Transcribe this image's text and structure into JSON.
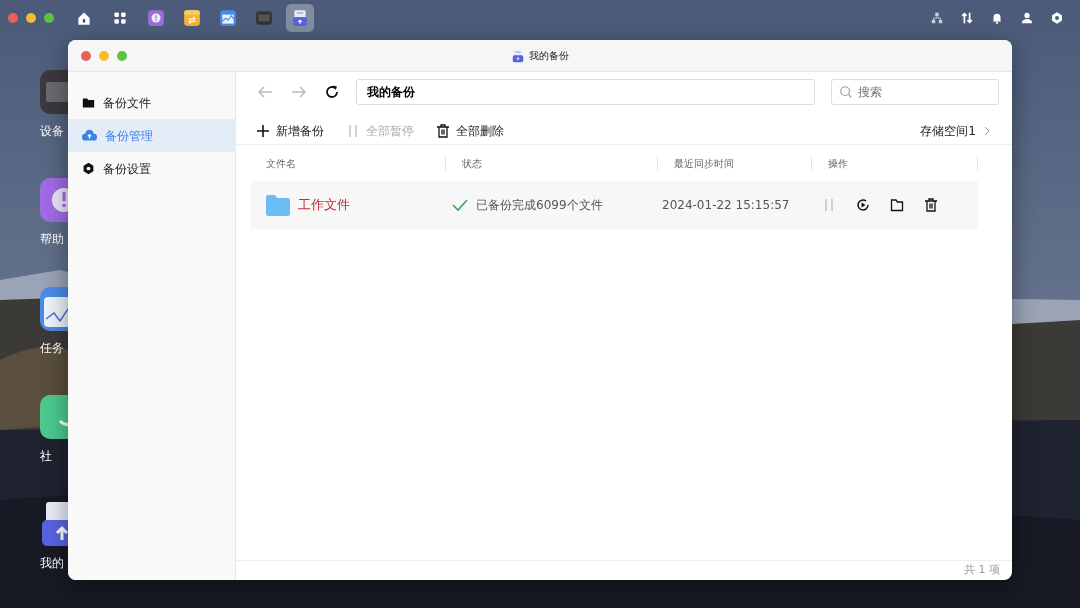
{
  "menu_bar": {
    "apps": [
      {
        "kind": "home",
        "selected": false
      },
      {
        "kind": "grid",
        "selected": false
      },
      {
        "kind": "help",
        "selected": false
      },
      {
        "kind": "sync",
        "selected": false
      },
      {
        "kind": "monitor",
        "selected": false
      },
      {
        "kind": "device",
        "selected": false
      },
      {
        "kind": "backup",
        "selected": true
      }
    ],
    "tray": [
      {
        "kind": "network"
      },
      {
        "kind": "transfer"
      },
      {
        "kind": "bell"
      },
      {
        "kind": "user"
      },
      {
        "kind": "settings"
      }
    ]
  },
  "desktop_icons": [
    {
      "label": "设备",
      "kind": "device"
    },
    {
      "label": "帮助",
      "kind": "help"
    },
    {
      "label": "任务",
      "kind": "monitor"
    },
    {
      "label": "社",
      "kind": "community"
    },
    {
      "label": "我的",
      "kind": "backup"
    }
  ],
  "window": {
    "title": "我的备份",
    "sidebar": [
      {
        "label": "备份文件",
        "kind": "folder",
        "selected": false
      },
      {
        "label": "备份管理",
        "kind": "cloud",
        "selected": true
      },
      {
        "label": "备份设置",
        "kind": "gear",
        "selected": false
      }
    ],
    "nav": {
      "back_disabled": true,
      "forward_disabled": true,
      "path": "我的备份",
      "search": {
        "placeholder": "搜索"
      }
    },
    "actions": [
      {
        "label": "新增备份",
        "kind": "add",
        "disabled": false
      },
      {
        "label": "全部暂停",
        "kind": "pause",
        "disabled": true
      },
      {
        "label": "全部删除",
        "kind": "delete",
        "disabled": false
      }
    ],
    "storage": "存储空间1",
    "table": {
      "columns": [
        "文件名",
        "状态",
        "最近同步时间",
        "操作"
      ],
      "rows": [
        {
          "name": "工作文件",
          "status": "已备份完成6099个文件",
          "time": "2024-01-22 15:15:57",
          "selected": false
        }
      ]
    },
    "footer": "共 1 项"
  }
}
